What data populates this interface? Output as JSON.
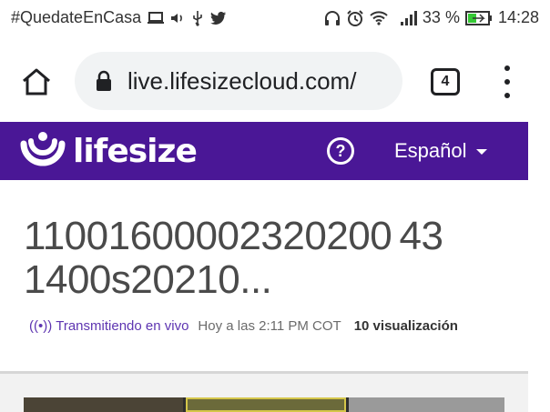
{
  "status_bar": {
    "hashtag": "#QuedateEnCasa",
    "battery": "33 %",
    "time": "14:28"
  },
  "browser": {
    "url": "live.lifesizecloud.com/",
    "tab_count": "4"
  },
  "header": {
    "brand": "lifesize",
    "help": "?",
    "language": "Español",
    "background_color": "#4a1796"
  },
  "event": {
    "title_line1": "11001600002320200 43",
    "title_line2": "1400s20210...",
    "live_label": "Transmitiendo en vivo",
    "time": "Hoy a las 2:11 PM COT",
    "views": "10 visualización"
  }
}
